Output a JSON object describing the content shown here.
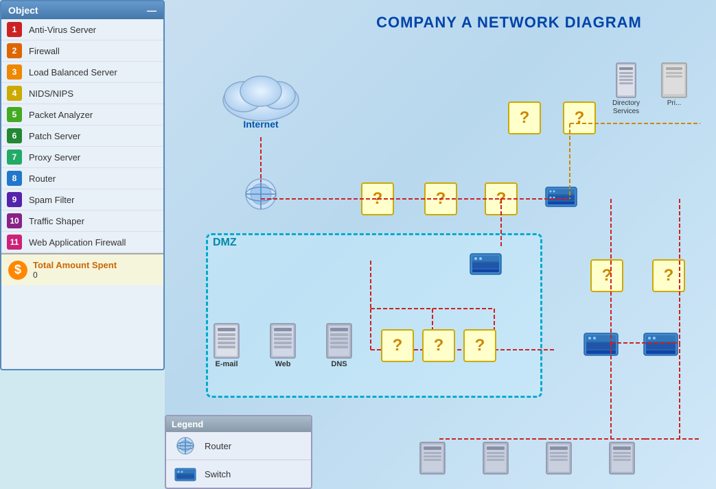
{
  "sidebar": {
    "header": "Object",
    "close_btn": "—",
    "items": [
      {
        "id": 1,
        "label": "Anti-Virus Server",
        "color": "#cc2222"
      },
      {
        "id": 2,
        "label": "Firewall",
        "color": "#dd6600"
      },
      {
        "id": 3,
        "label": "Load Balanced Server",
        "color": "#ee8800"
      },
      {
        "id": 4,
        "label": "NIDS/NIPS",
        "color": "#ccaa00"
      },
      {
        "id": 5,
        "label": "Packet Analyzer",
        "color": "#44aa22"
      },
      {
        "id": 6,
        "label": "Patch Server",
        "color": "#228833"
      },
      {
        "id": 7,
        "label": "Proxy Server",
        "color": "#22aa66"
      },
      {
        "id": 8,
        "label": "Router",
        "color": "#2277cc"
      },
      {
        "id": 9,
        "label": "Spam Filter",
        "color": "#5522aa"
      },
      {
        "id": 10,
        "label": "Traffic Shaper",
        "color": "#882288"
      },
      {
        "id": 11,
        "label": "Web Application Firewall",
        "color": "#cc2277"
      }
    ],
    "total_label": "Total Amount Spent",
    "total_amount": "0"
  },
  "diagram": {
    "title": "COMPANY A NETWORK DIAGRAM",
    "internet_label": "Internet",
    "dmz_label": "DMZ",
    "nodes": {
      "email_label": "E-mail",
      "web_label": "Web",
      "dns_label": "DNS"
    },
    "directory_label": "Directory\nServices",
    "printer_label": "Pri..."
  },
  "legend": {
    "header": "Legend",
    "items": [
      {
        "label": "Router",
        "icon": "router"
      },
      {
        "label": "Switch",
        "icon": "switch"
      }
    ]
  }
}
